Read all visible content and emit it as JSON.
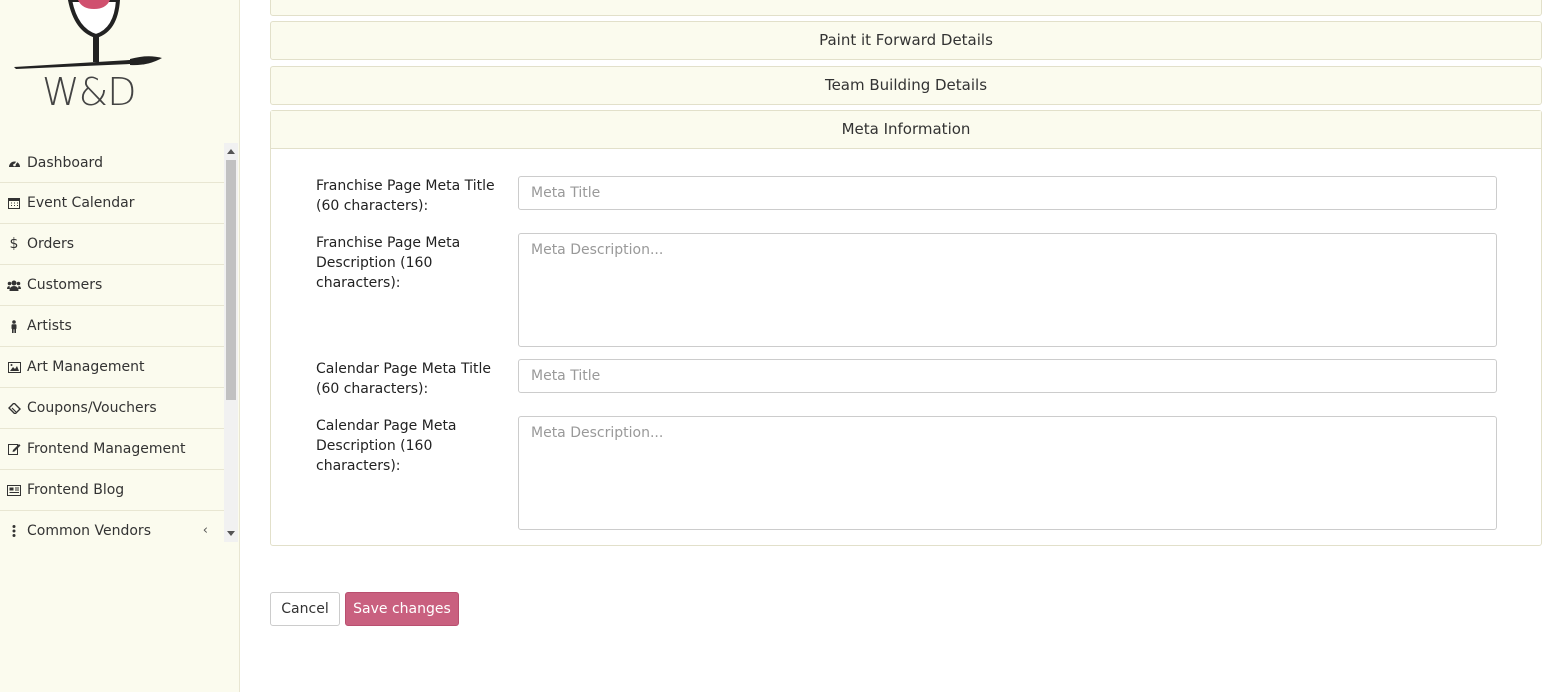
{
  "brand": {
    "logo_text": "W&D"
  },
  "sidebar": {
    "items": [
      {
        "label": "Dashboard",
        "icon": "dashboard-icon"
      },
      {
        "label": "Event Calendar",
        "icon": "calendar-icon"
      },
      {
        "label": "Orders",
        "icon": "dollar-icon"
      },
      {
        "label": "Customers",
        "icon": "users-icon"
      },
      {
        "label": "Artists",
        "icon": "person-icon"
      },
      {
        "label": "Art Management",
        "icon": "image-icon"
      },
      {
        "label": "Coupons/Vouchers",
        "icon": "ticket-icon"
      },
      {
        "label": "Frontend Management",
        "icon": "edit-icon"
      },
      {
        "label": "Frontend Blog",
        "icon": "newspaper-icon"
      },
      {
        "label": "Common Vendors",
        "icon": "vertical-ellipsis-icon",
        "expandable": true
      }
    ]
  },
  "sections": {
    "paint_it_forward": "Paint it Forward Details",
    "team_building": "Team Building Details",
    "meta_information": "Meta Information"
  },
  "meta_form": {
    "franchise_title_label": "Franchise Page Meta Title (60 characters):",
    "franchise_title_placeholder": "Meta Title",
    "franchise_desc_label": "Franchise Page Meta Description (160 characters):",
    "franchise_desc_placeholder": "Meta Description...",
    "calendar_title_label": "Calendar Page Meta Title (60 characters):",
    "calendar_title_placeholder": "Meta Title",
    "calendar_desc_label": "Calendar Page Meta Description (160 characters):",
    "calendar_desc_placeholder": "Meta Description..."
  },
  "actions": {
    "cancel": "Cancel",
    "save": "Save changes"
  },
  "colors": {
    "sidebar_bg": "#fbfbee",
    "save_button": "#c9607f",
    "brand_accent": "#d0506e"
  }
}
